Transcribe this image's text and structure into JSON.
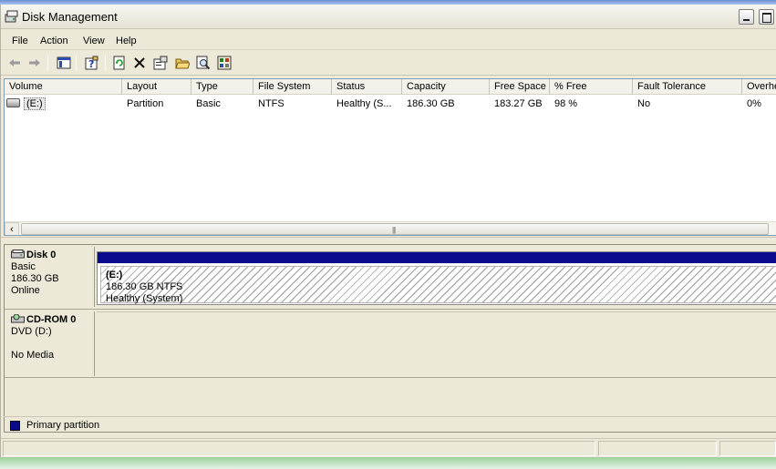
{
  "window": {
    "title": "Disk Management",
    "icon": "disk-management-icon"
  },
  "menu": [
    "File",
    "Action",
    "View",
    "Help"
  ],
  "toolbar": [
    "back-arrow-icon",
    "forward-arrow-icon",
    "show-hide-console-tree-icon",
    "help-icon",
    "refresh-icon",
    "delete-icon",
    "properties-icon",
    "open-folder-icon",
    "explore-icon",
    "rescan-disks-icon"
  ],
  "volume_list": {
    "columns": [
      "Volume",
      "Layout",
      "Type",
      "File System",
      "Status",
      "Capacity",
      "Free Space",
      "% Free",
      "Fault Tolerance",
      "Overhead"
    ],
    "rows": [
      {
        "volume": "(E:)",
        "layout": "Partition",
        "type": "Basic",
        "file_system": "NTFS",
        "status": "Healthy (S...",
        "capacity": "186.30 GB",
        "free_space": "183.27 GB",
        "pct_free": "98 %",
        "fault_tolerance": "No",
        "overhead": "0%"
      }
    ]
  },
  "disks": [
    {
      "name": "Disk 0",
      "type": "Basic",
      "size": "186.30 GB",
      "state": "Online",
      "partition": {
        "name": "(E:)",
        "detail": "186.30 GB NTFS",
        "status": "Healthy (System)"
      }
    },
    {
      "name": "CD-ROM 0",
      "type": "DVD (D:)",
      "media": "No Media"
    }
  ],
  "legend": {
    "label": "Primary partition",
    "color": "#0a0a8c"
  }
}
